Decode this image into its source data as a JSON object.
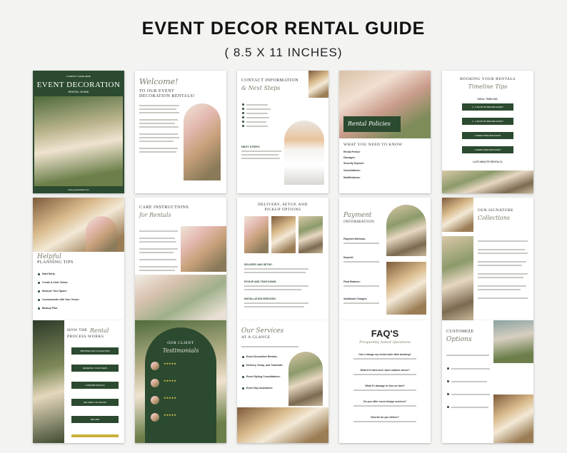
{
  "header": {
    "title": "EVENT DECOR RENTAL GUIDE",
    "subtitle": "( 8.5 X 11 INCHES)"
  },
  "pages": {
    "p1": {
      "company": "COMPANY NAME HERE",
      "title": "EVENT DECORATION",
      "sub": "RENTAL GUIDE",
      "footer": "www.yourwebsite.com"
    },
    "p2": {
      "script": "Welcome!",
      "heading1": "TO OUR EVENT",
      "heading2": "DECORATION RENTALS!"
    },
    "p3": {
      "heading": "CONTACT INFORMATION",
      "script": "& Next Steps",
      "next": "NEXT STEPS:"
    },
    "p4": {
      "script": "Rental Policies",
      "heading": "WHAT YOU NEED TO KNOW",
      "items": [
        "Rental Period:",
        "Damages:",
        "Security Deposit:",
        "Cancellations:",
        "Modifications:"
      ]
    },
    "p5": {
      "heading": "BOOKING YOUR RENTALS",
      "script": "Timeline Tips",
      "ideal": "IDEAL TIMELINE:",
      "steps": [
        "3 - 6 MONTHS BEFORE EVENT",
        "2 - 3 MONTHS BEFORE EVENT",
        "2 WEEKS BEFORE EVENT",
        "2 WEEKS BEFORE EVENT"
      ],
      "last": "LAST-MINUTE RENTALS:"
    },
    "p6": {
      "script": "Helpful",
      "heading": "PLANNING TIPS",
      "items": [
        "Start Early:",
        "Create A Clear Vision:",
        "Measure Your Space:",
        "Communicate with Your Venue:",
        "Backup Plan:"
      ]
    },
    "p7": {
      "heading": "CARE INSTRUCTIONS",
      "script": "for Rentals"
    },
    "p8": {
      "heading1": "DELIVERY, SETUP, AND",
      "heading2": "PICKUP OPTIONS",
      "items": [
        "DELIVERY AND SETUP:",
        "PICKUP AND TEAR DOWN:",
        "INSTALLATION SERVICES:"
      ]
    },
    "p9": {
      "script": "Payment",
      "heading": "INFORMATION",
      "items": [
        "Payment Methods:",
        "Deposit:",
        "Final Balance:",
        "Additional Charges:"
      ]
    },
    "p10": {
      "heading": "OUR SIGNATURE",
      "script": "Collections"
    },
    "p11": {
      "heading1": "HOW THE",
      "script": "Rental",
      "heading2": "PROCESS WORKS",
      "steps": [
        "BROWSE OUR COLLECTION",
        "RESERVE YOUR ITEMS",
        "CONFIRM DETAILS",
        "DELIVERY OR PICKUP",
        "RETURN"
      ]
    },
    "p12": {
      "heading": "OUR CLIENT",
      "script": "Testimonials",
      "stars": "★★★★★"
    },
    "p13": {
      "script": "Our Services",
      "heading": "AT A GLANCE",
      "items": [
        "Event Decoration Rentals:",
        "Delivery, Setup, and Teardown:",
        "Event Styling Consultations:",
        "Event Day Assistance:"
      ]
    },
    "p14": {
      "heading": "FAQ'S",
      "script": "Frequently Asked Questions",
      "questions": [
        "Can I change my rental order after booking?",
        "What if it rains and I have outdoor decor?",
        "What if I damage or lose an item?",
        "Do you offer event design services?",
        "How far do you deliver?"
      ]
    },
    "p15": {
      "heading": "CUSTOMIZE",
      "script": "Options"
    }
  },
  "colors": {
    "brand_green": "#2b4a2f",
    "background": "#f3f3f2"
  }
}
